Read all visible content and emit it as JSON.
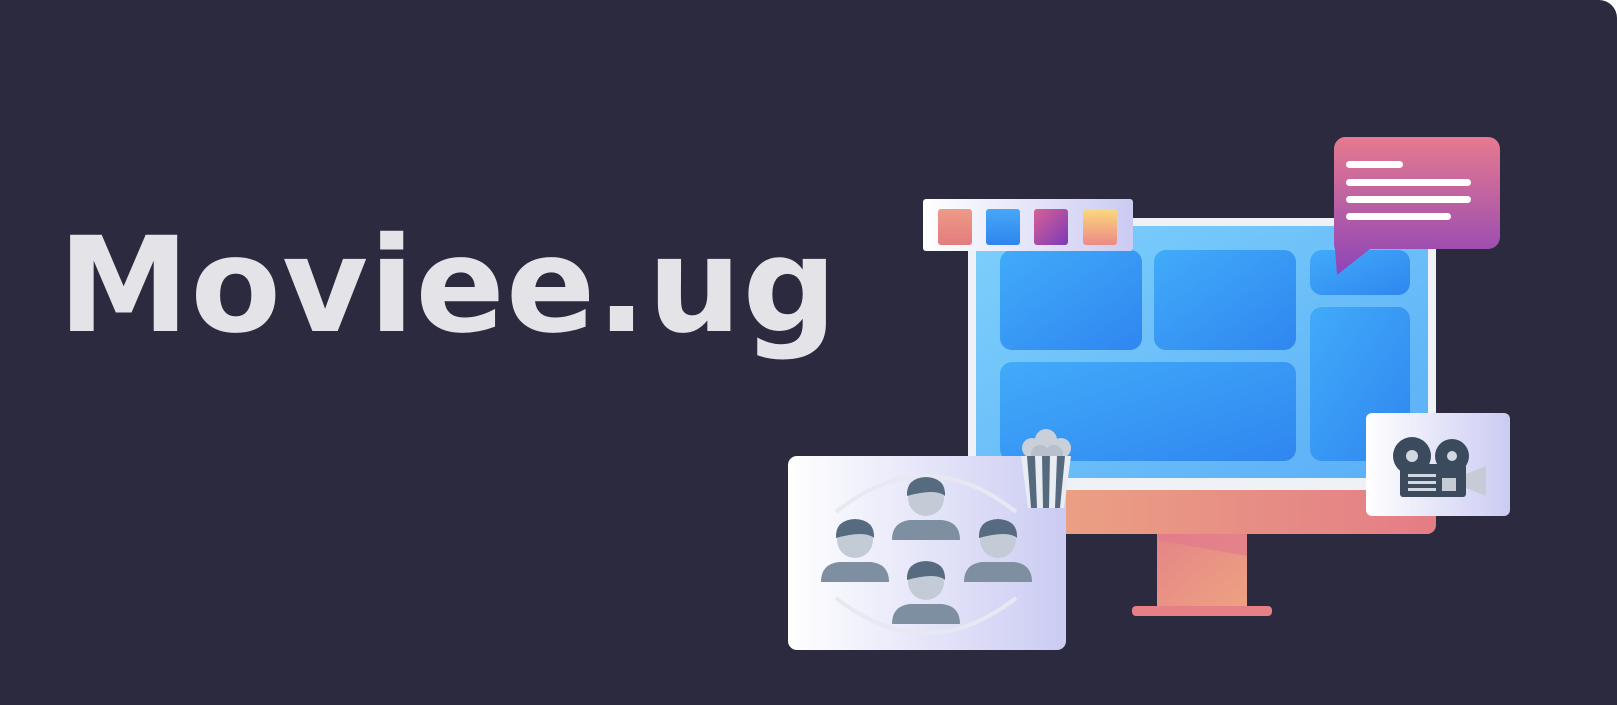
{
  "brand": {
    "title": "Moviee.ug"
  },
  "illustration": {
    "palette_swatches": [
      "#ea8c82",
      "#3f95f0",
      "#9c4aa6",
      "#f8c67c"
    ],
    "colors": {
      "background": "#2b2a3f",
      "title_text": "#e4e3e8",
      "screen_blue": "#3b9df5",
      "monitor_stand_pink": "#e8807f",
      "chat_bubble_top": "#e57a93",
      "chat_bubble_bottom": "#8d43b6",
      "person_icon": "#7d8fa0"
    },
    "icons": [
      "palette-swatch-icon",
      "chat-bubble-icon",
      "popcorn-icon",
      "people-group-icon",
      "film-camera-icon",
      "monitor-icon"
    ]
  }
}
